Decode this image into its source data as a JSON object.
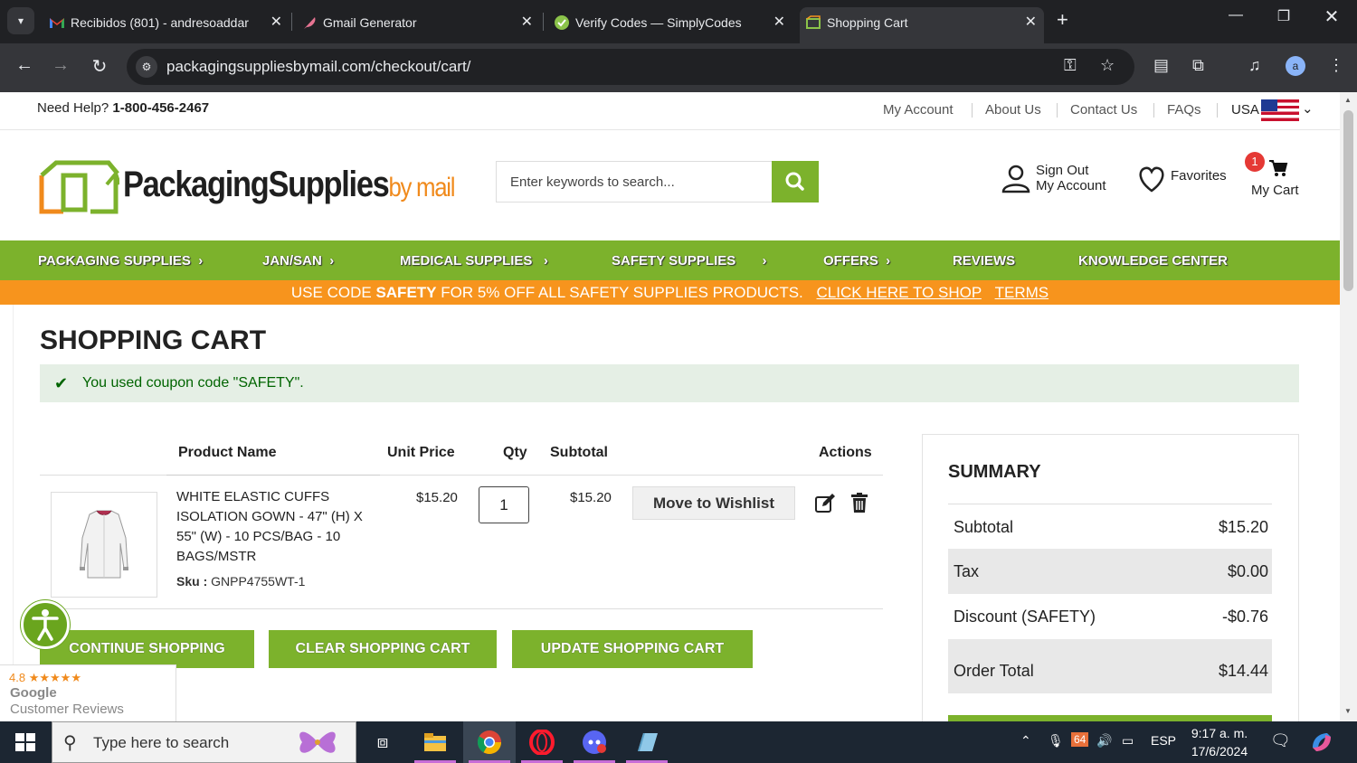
{
  "browser": {
    "tabs": [
      {
        "title": "Recibidos (801) - andresoaddar",
        "icon": "gmail-icon"
      },
      {
        "title": "Gmail Generator",
        "icon": "feather-icon"
      },
      {
        "title": "Verify Codes — SimplyCodes",
        "icon": "simplycodes-icon"
      },
      {
        "title": "Shopping Cart",
        "icon": "box-icon"
      }
    ],
    "url": "packagingsuppliesbymail.com/checkout/cart/",
    "profile_initial": "a"
  },
  "site": {
    "help_label": "Need Help?",
    "help_phone": "1-800-456-2467",
    "top_links": [
      "My Account",
      "About Us",
      "Contact Us",
      "FAQs"
    ],
    "country": "USA",
    "logo_main": "PackagingSupplies",
    "logo_suffix": "by mail",
    "search_placeholder": "Enter keywords to search...",
    "account_line1": "Sign Out",
    "account_line2": "My Account",
    "favorites_label": "Favorites",
    "cart_count": "1",
    "cart_label": "My Cart",
    "nav": [
      "PACKAGING SUPPLIES",
      "JAN/SAN",
      "MEDICAL SUPPLIES",
      "SAFETY SUPPLIES",
      "OFFERS",
      "REVIEWS",
      "KNOWLEDGE CENTER"
    ],
    "promo_prefix": "USE CODE",
    "promo_code": "SAFETY",
    "promo_text": "FOR 5% OFF ALL SAFETY SUPPLIES PRODUCTS.",
    "promo_link": "CLICK HERE TO SHOP",
    "promo_terms": "TERMS"
  },
  "cart": {
    "title": "SHOPPING CART",
    "message": "You used coupon code \"SAFETY\".",
    "headers": {
      "name": "Product Name",
      "price": "Unit Price",
      "qty": "Qty",
      "subtotal": "Subtotal",
      "actions": "Actions"
    },
    "item": {
      "name": "WHITE ELASTIC CUFFS ISOLATION GOWN - 47\" (H) X 55\" (W) - 10 PCS/BAG - 10 BAGS/MSTR",
      "sku_label": "Sku :",
      "sku": "GNPP4755WT-1",
      "price": "$15.20",
      "qty": "1",
      "subtotal": "$15.20",
      "wishlist_label": "Move to Wishlist"
    },
    "buttons": {
      "continue": "CONTINUE SHOPPING",
      "clear": "CLEAR SHOPPING CART",
      "update": "UPDATE SHOPPING CART"
    }
  },
  "summary": {
    "title": "SUMMARY",
    "rows": [
      {
        "label": "Subtotal",
        "value": "$15.20"
      },
      {
        "label": "Tax",
        "value": "$0.00"
      },
      {
        "label": "Discount (SAFETY)",
        "value": "-$0.76"
      },
      {
        "label": "Order Total",
        "value": "$14.44"
      }
    ]
  },
  "reviews": {
    "rating": "4.8",
    "stars": "★★★★★",
    "line1": "Google",
    "line2": "Customer Reviews"
  },
  "taskbar": {
    "search_placeholder": "Type here to search",
    "badge_count": "64",
    "language": "ESP",
    "time": "9:17 a. m.",
    "date": "17/6/2024"
  },
  "colors": {
    "brand_green": "#7cb22c",
    "promo_orange": "#f7941d",
    "chrome_dark": "#202124"
  }
}
